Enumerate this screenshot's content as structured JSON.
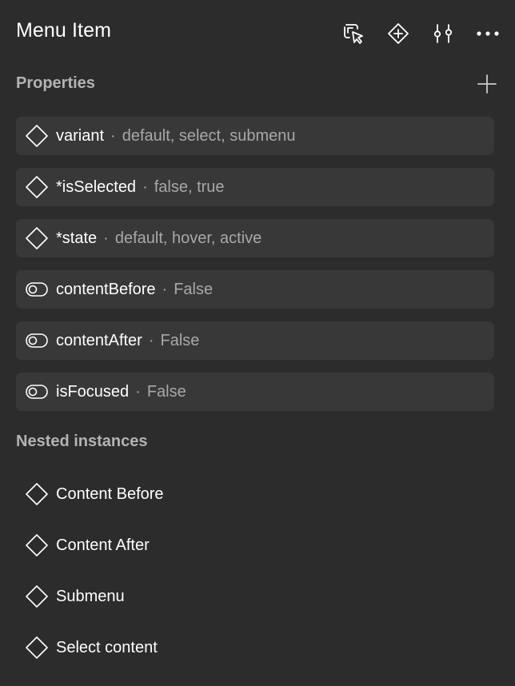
{
  "panel": {
    "title": "Menu Item",
    "header_icons": [
      "select-matching-layers-icon",
      "component-instance-icon",
      "adjust-sliders-icon",
      "more-options-icon"
    ]
  },
  "properties": {
    "title": "Properties",
    "add_icon": "plus-icon",
    "items": [
      {
        "icon": "variant-diamond-icon",
        "name": "variant",
        "separator": "·",
        "values": "default, select, submenu"
      },
      {
        "icon": "variant-diamond-icon",
        "name": "*isSelected",
        "separator": "·",
        "values": "false, true"
      },
      {
        "icon": "variant-diamond-icon",
        "name": "*state",
        "separator": "·",
        "values": "default, hover, active"
      },
      {
        "icon": "boolean-toggle-icon",
        "name": "contentBefore",
        "separator": "·",
        "values": "False"
      },
      {
        "icon": "boolean-toggle-icon",
        "name": "contentAfter",
        "separator": "·",
        "values": "False"
      },
      {
        "icon": "boolean-toggle-icon",
        "name": "isFocused",
        "separator": "·",
        "values": "False"
      }
    ]
  },
  "nested_instances": {
    "title": "Nested instances",
    "items": [
      {
        "icon": "instance-diamond-icon",
        "label": "Content Before"
      },
      {
        "icon": "instance-diamond-icon",
        "label": "Content After"
      },
      {
        "icon": "instance-diamond-icon",
        "label": "Submenu"
      },
      {
        "icon": "instance-diamond-icon",
        "label": "Select content"
      }
    ]
  },
  "colors": {
    "background": "#2c2c2c",
    "row_background": "#383838",
    "text_primary": "#ffffff",
    "text_secondary": "#a8a8a8"
  }
}
